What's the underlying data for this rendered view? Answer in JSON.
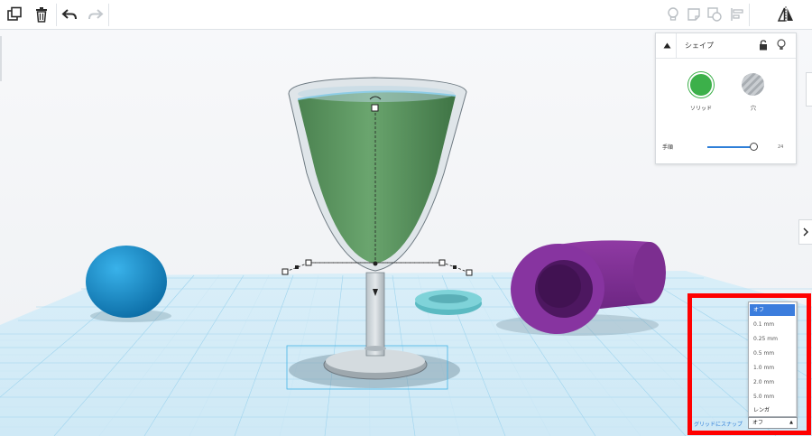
{
  "toolbar": {
    "left_tools": [
      "duplicate-icon",
      "trash-icon",
      "undo-icon",
      "redo-icon"
    ],
    "right_tools": [
      "lightbulb-icon",
      "note-icon",
      "group-icon",
      "align-icon",
      "mirror-icon"
    ]
  },
  "shape_panel": {
    "title": "シェイプ",
    "solid_label": "ソリッド",
    "hole_label": "穴",
    "slider_label": "手順",
    "slider_value": "24",
    "solid_color": "#3cb04a"
  },
  "snap": {
    "label": "グリッドにスナップ",
    "selected": "オフ",
    "options": [
      "オフ",
      "0.1 mm",
      "0.25 mm",
      "0.5 mm",
      "1.0 mm",
      "2.0 mm",
      "5.0 mm",
      "レンガ"
    ]
  },
  "scene_colors": {
    "grid": "#8fd0ec",
    "glass_liquid": "#5d9a62",
    "sphere": "#1c8fcf",
    "tube": "#7a2b8f",
    "torus": "#6fcbd2"
  }
}
